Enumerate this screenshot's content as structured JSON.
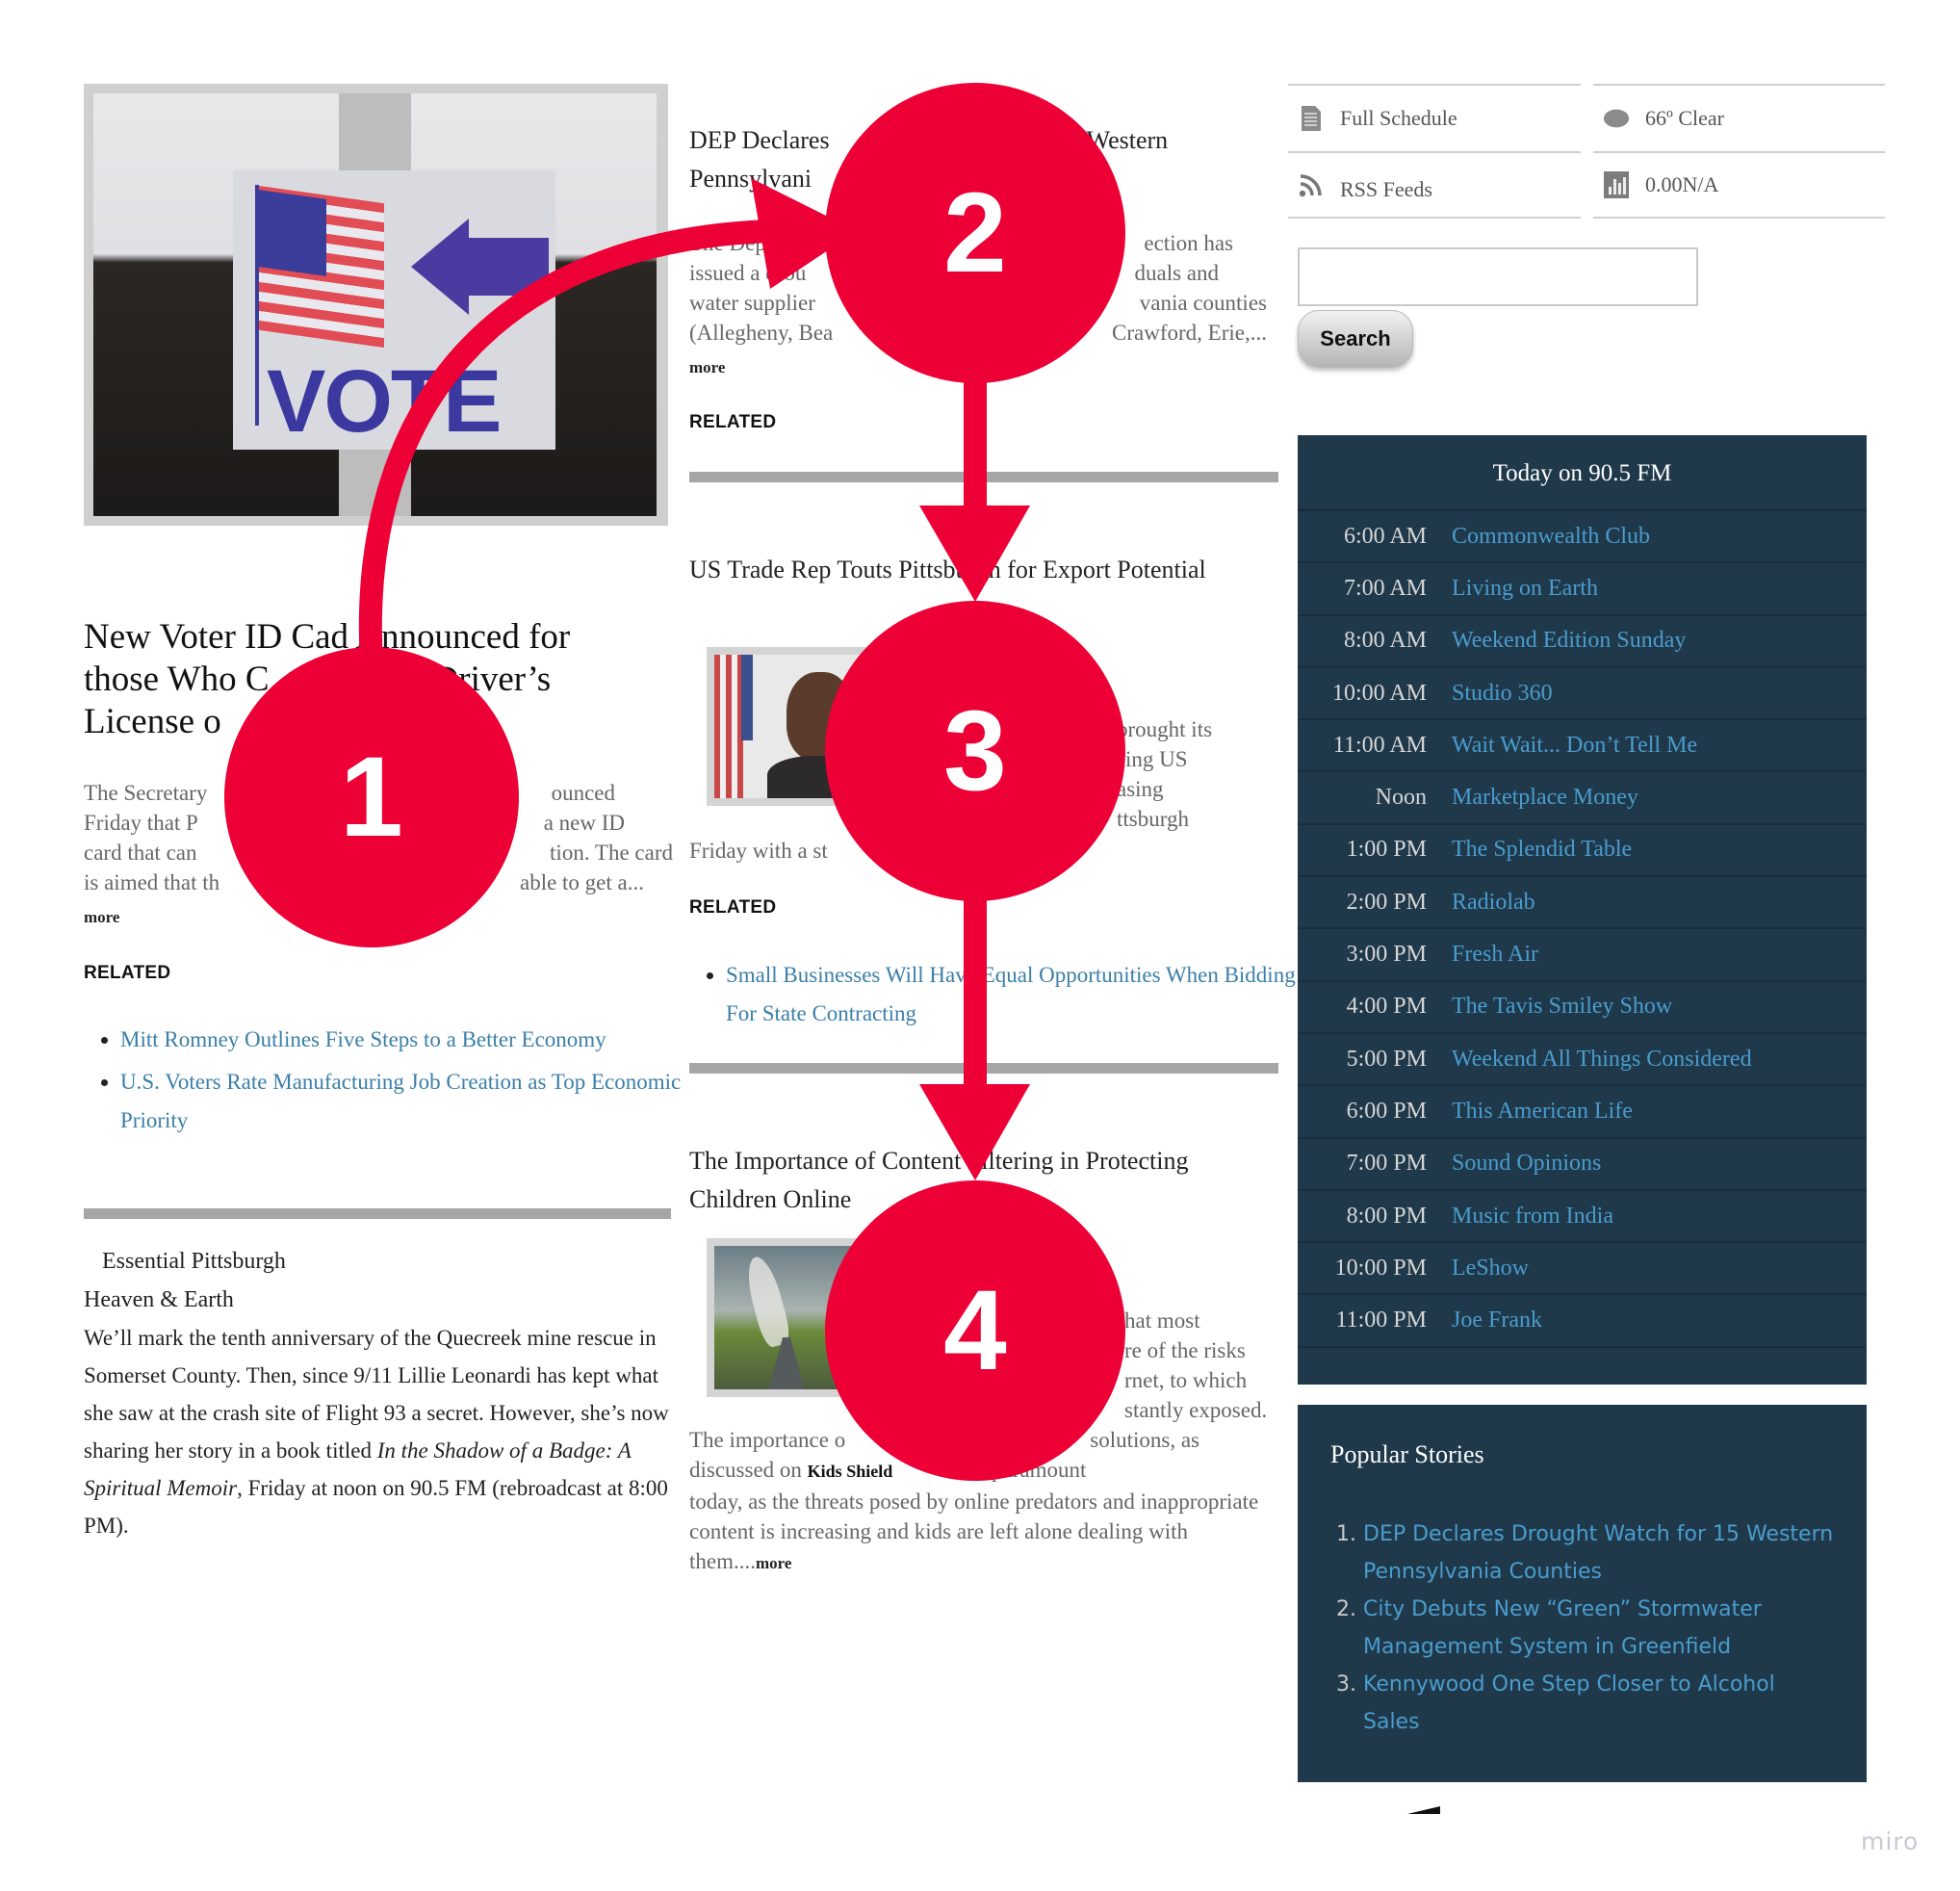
{
  "left": {
    "hero_image_alt": "VOTE sign with American flag and arrow",
    "hero_sign_text": "VOTE",
    "headline": "New Voter ID Card Announced for those Who Cannot Get a Driver's License or",
    "headline_visible_lines": [
      "New Voter ID Ca​d Announced for",
      "those Who C",
      "Driver’s",
      "License o"
    ],
    "excerpt_lines": [
      "The Secretary",
      "ounced",
      "Friday that P",
      "a new ID",
      "card that can",
      "tion. The card",
      "is aimed that th",
      "able to get a..."
    ],
    "more": "more",
    "related_label": "RELATED",
    "related": [
      "Mitt Romney Outlines Five Steps to a Better Economy",
      "U.S. Voters Rate Manufacturing Job Creation as Top Economic Priority"
    ],
    "essential": {
      "label": "Essential Pittsburgh",
      "title": "Heaven & Earth",
      "body_before_italic": "We’ll mark the tenth anniversary of the Quecreek mine rescue in Somerset County. Then, since 9/11 Lillie Leonardi has kept what she saw at the crash site of Flight 93 a secret. However, she’s now sharing her story in a book titled ",
      "book_title": "In the Shadow of a Badge: A Spiritual Memoir",
      "body_after_italic": ", Friday at noon on 90.5 FM (rebroadcast at 8:00 PM)."
    }
  },
  "middle": {
    "article1": {
      "title_left": "DEP Declares ",
      "title_right": "15 Western",
      "title_line2": "Pennsylvani",
      "excerpt_lines": [
        {
          "l": "The Departm",
          "r": "ection has"
        },
        {
          "l": "issued a drou",
          "r": "duals and"
        },
        {
          "l": "water supplier",
          "r": "vania counties"
        },
        {
          "l": "(Allegheny, Bea",
          "r": "Crawford, Erie,..."
        }
      ],
      "more": "more",
      "related_label": "RELATED"
    },
    "article2": {
      "title": "US Trade Rep Touts Pittsburgh for Export Potential",
      "excerpt_lines": [
        "brought its",
        "sing US",
        "asing",
        "ttsburgh"
      ],
      "excerpt_tail": "Friday with a st",
      "related_label": "RELATED",
      "related": [
        "Small Businesses Will Have Equal Opportunities When Bidding For State Contracting"
      ]
    },
    "article3": {
      "title": "The Importance of Content Filtering in Protecting Children Online",
      "excerpt_lines": [
        "hat most",
        "re of the risks",
        "rnet, to which",
        "stantly exposed."
      ],
      "body_start": "The importance o",
      "body_start_r": "solutions, as",
      "discussed_on": "discussed on ",
      "site_name": "Kids Shield",
      "discussed_tail": "e, is paramount",
      "body_rest": "today, as the threats posed by online predators and inappropriate content is increasing and kids are left alone dealing with them....",
      "more": "more"
    }
  },
  "right": {
    "links": [
      {
        "icon": "document-icon",
        "label": "Full Schedule"
      },
      {
        "icon": "weather-icon",
        "label": "66º Clear"
      },
      {
        "icon": "rss-icon",
        "label": "RSS Feeds"
      },
      {
        "icon": "bar-chart-icon",
        "label": "0.00N/A"
      }
    ],
    "search": {
      "value": "",
      "placeholder": "",
      "button": "Search"
    },
    "schedule": {
      "title": "Today on 90.5 FM",
      "rows": [
        {
          "time": "6:00 AM",
          "show": "Commonwealth Club"
        },
        {
          "time": "7:00 AM",
          "show": "Living on Earth"
        },
        {
          "time": "8:00 AM",
          "show": "Weekend Edition Sunday"
        },
        {
          "time": "10:00 AM",
          "show": "Studio 360"
        },
        {
          "time": "11:00 AM",
          "show": "Wait Wait... Don’t Tell Me"
        },
        {
          "time": "Noon",
          "show": "Marketplace Money"
        },
        {
          "time": "1:00 PM",
          "show": "The Splendid Table"
        },
        {
          "time": "2:00 PM",
          "show": "Radiolab"
        },
        {
          "time": "3:00 PM",
          "show": "Fresh Air"
        },
        {
          "time": "4:00 PM",
          "show": "The Tavis Smiley Show"
        },
        {
          "time": "5:00 PM",
          "show": "Weekend All Things Considered"
        },
        {
          "time": "6:00 PM",
          "show": "This American Life"
        },
        {
          "time": "7:00 PM",
          "show": "Sound Opinions"
        },
        {
          "time": "8:00 PM",
          "show": "Music from India"
        },
        {
          "time": "10:00 PM",
          "show": "LeShow"
        },
        {
          "time": "11:00 PM",
          "show": "Joe Frank"
        }
      ]
    },
    "popular": {
      "title": "Popular Stories",
      "items": [
        "DEP Declares Drought Watch for 15 Western Pennsylvania Counties",
        "City Debuts New “Green” Stormwater Management System in Greenfield",
        "Kennywood One Step Closer to Alcohol Sales"
      ]
    }
  },
  "annotations": {
    "color": "#ed0036",
    "steps": [
      "1",
      "2",
      "3",
      "4"
    ]
  },
  "watermark": "miro",
  "colors": {
    "panel_bg": "#1f394b",
    "link_blue": "#3b7fa8",
    "panel_link": "#4a9ccd",
    "divider": "#a6a6a6"
  }
}
